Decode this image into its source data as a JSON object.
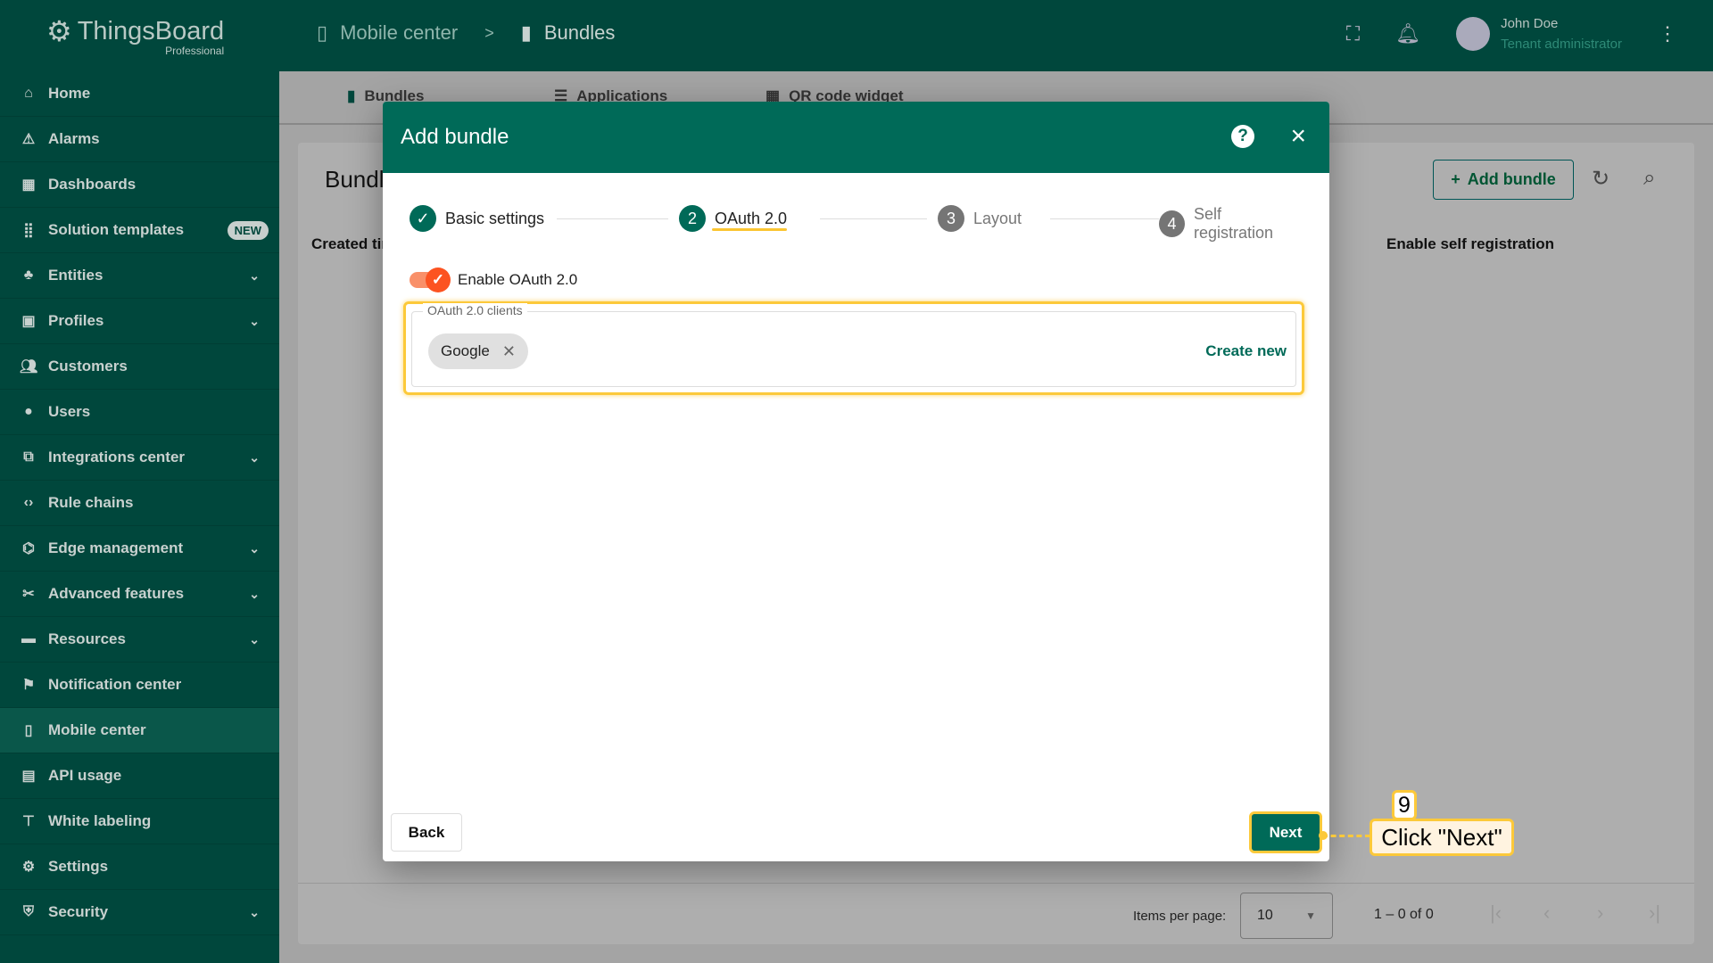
{
  "app": {
    "name": "ThingsBoard",
    "edition": "Professional"
  },
  "breadcrumb": {
    "parent": "Mobile center",
    "separator": ">",
    "current": "Bundles"
  },
  "user": {
    "name": "John Doe",
    "role": "Tenant administrator"
  },
  "sidebar": {
    "items": [
      {
        "label": "Home",
        "icon": "home-icon"
      },
      {
        "label": "Alarms",
        "icon": "warning-icon"
      },
      {
        "label": "Dashboards",
        "icon": "dashboard-icon"
      },
      {
        "label": "Solution templates",
        "icon": "grid-icon",
        "badge": "NEW"
      },
      {
        "label": "Entities",
        "icon": "entities-icon",
        "expandable": true
      },
      {
        "label": "Profiles",
        "icon": "profiles-icon",
        "expandable": true
      },
      {
        "label": "Customers",
        "icon": "people-icon"
      },
      {
        "label": "Users",
        "icon": "user-icon"
      },
      {
        "label": "Integrations center",
        "icon": "integrations-icon",
        "expandable": true
      },
      {
        "label": "Rule chains",
        "icon": "code-icon"
      },
      {
        "label": "Edge management",
        "icon": "edge-icon",
        "expandable": true
      },
      {
        "label": "Advanced features",
        "icon": "tools-icon",
        "expandable": true
      },
      {
        "label": "Resources",
        "icon": "folder-icon",
        "expandable": true
      },
      {
        "label": "Notification center",
        "icon": "notification-icon"
      },
      {
        "label": "Mobile center",
        "icon": "mobile-icon",
        "active": true
      },
      {
        "label": "API usage",
        "icon": "chart-icon"
      },
      {
        "label": "White labeling",
        "icon": "paint-icon"
      },
      {
        "label": "Settings",
        "icon": "gear-icon"
      },
      {
        "label": "Security",
        "icon": "shield-icon",
        "expandable": true
      }
    ]
  },
  "tabs": [
    "Bundles",
    "Applications",
    "QR code widget"
  ],
  "card": {
    "title": "Bundles",
    "col_created": "Created time",
    "col_self_reg": "Enable self registration",
    "add_label": "Add bundle"
  },
  "pagination": {
    "items_per_page_label": "Items per page:",
    "items_per_page": "10",
    "range": "1 – 0 of 0"
  },
  "dialog": {
    "title": "Add bundle",
    "steps": [
      {
        "num": "✓",
        "label": "Basic settings",
        "state": "done"
      },
      {
        "num": "2",
        "label": "OAuth 2.0",
        "state": "active"
      },
      {
        "num": "3",
        "label": "Layout",
        "state": "pending"
      },
      {
        "num": "4",
        "label": "Self registration",
        "state": "pending"
      }
    ],
    "toggle_label": "Enable OAuth 2.0",
    "toggle_on": true,
    "clients_label": "OAuth 2.0 clients",
    "chips": [
      "Google"
    ],
    "create_new": "Create new",
    "back": "Back",
    "next": "Next"
  },
  "annotation": {
    "step": "9",
    "text": "Click \"Next\""
  },
  "colors": {
    "primary": "#006a58",
    "sidebar": "#00473c",
    "highlight": "#fcc93a",
    "toggle": "#fc5321"
  }
}
